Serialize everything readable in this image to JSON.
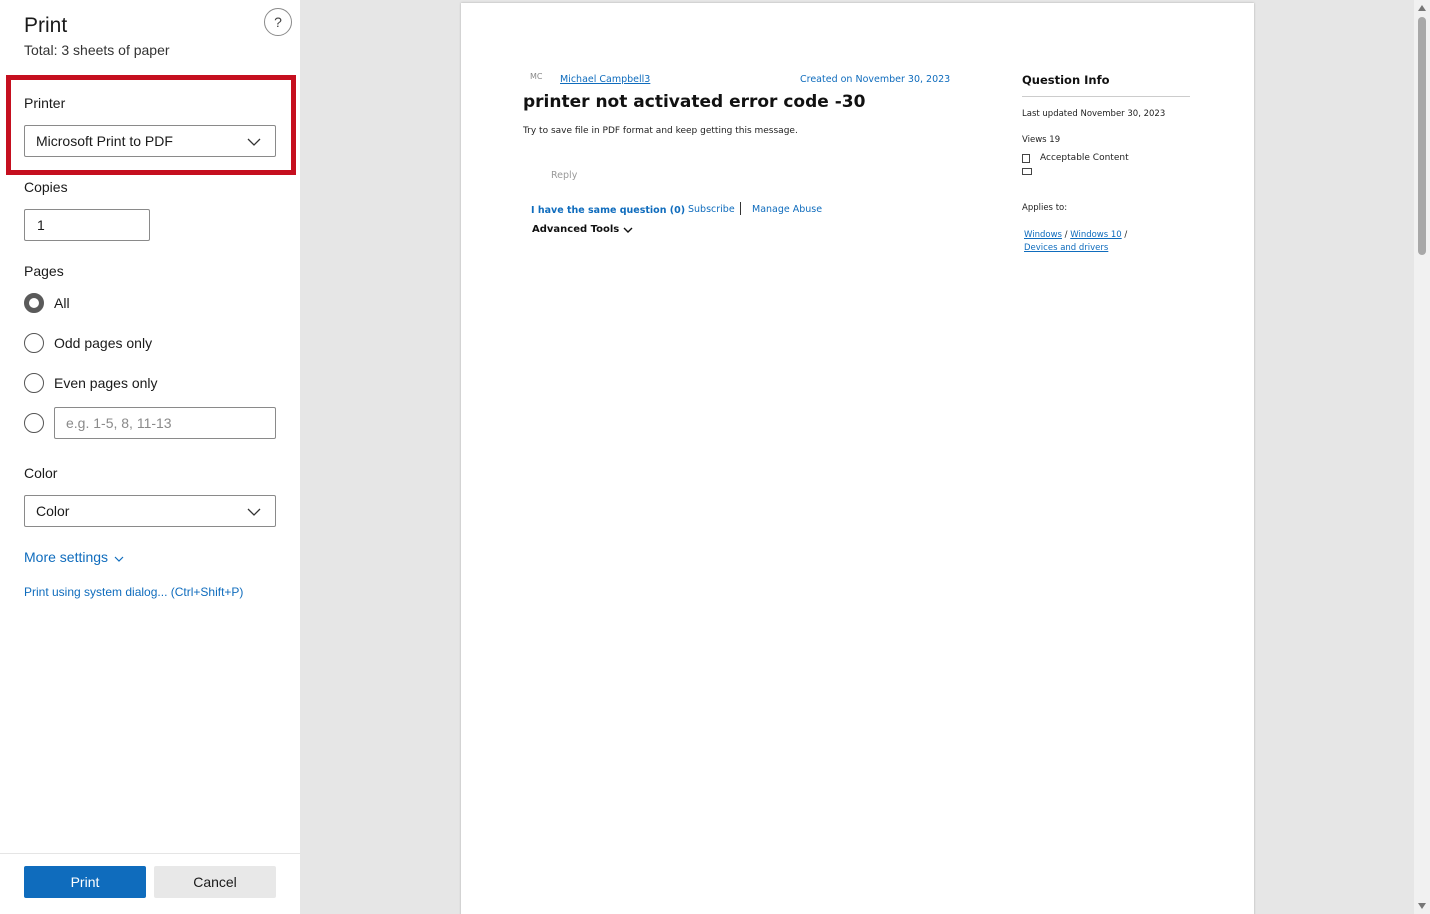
{
  "dialog": {
    "title": "Print",
    "subtitle": "Total: 3 sheets of paper",
    "help_icon": "?"
  },
  "printer": {
    "label": "Printer",
    "selected": "Microsoft Print to PDF"
  },
  "copies": {
    "label": "Copies",
    "value": "1"
  },
  "pages": {
    "label": "Pages",
    "options": [
      {
        "label": "All",
        "checked": true
      },
      {
        "label": "Odd pages only",
        "checked": false
      },
      {
        "label": "Even pages only",
        "checked": false
      }
    ],
    "custom_placeholder": "e.g. 1-5, 8, 11-13"
  },
  "color": {
    "label": "Color",
    "selected": "Color"
  },
  "more_settings": "More settings",
  "system_dialog": "Print using system dialog... (Ctrl+Shift+P)",
  "buttons": {
    "print": "Print",
    "cancel": "Cancel"
  },
  "preview": {
    "avatar": "MC",
    "author": "Michael Campbell3",
    "created": "Created on November 30, 2023",
    "question_title": "printer not activated error code -30",
    "question_body": "Try to save file in PDF format and keep getting this message.",
    "reply": "Reply",
    "same_question": "I have the same question (0)",
    "subscribe": "Subscribe",
    "manage_abuse": "Manage Abuse",
    "advanced_tools": "Advanced Tools",
    "info": {
      "title": "Question Info",
      "last_updated": "Last updated November 30, 2023",
      "views": "Views 19",
      "acceptable": "Acceptable Content",
      "applies_to": "Applies to:",
      "crumb_1": "Windows",
      "crumb_2": "Windows 10",
      "crumb_3": "Devices and drivers",
      "crumb_sep": "/"
    }
  },
  "colors": {
    "accent": "#0f6cbd",
    "highlight": "#c50f1f"
  }
}
